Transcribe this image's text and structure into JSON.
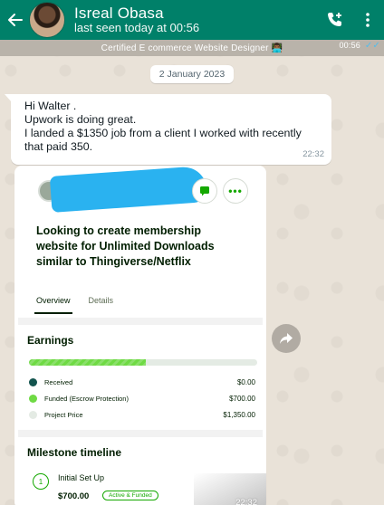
{
  "header": {
    "contact_name": "Isreal Obasa",
    "last_seen": "last seen today at 00:56"
  },
  "strip": {
    "text": "Certified E commerce Website Designer 👨🏾‍💻",
    "time": "00:56"
  },
  "date_chip": "2 January 2023",
  "message": {
    "lines": [
      "Hi Walter .",
      "Upwork is doing great.",
      "I landed a $1350 job from a client I worked with recently",
      "that paid 350."
    ],
    "time": "22:32"
  },
  "image_message": {
    "job_title": "Looking to create membership website for Unlimited Downloads similar to Thingiverse/Netflix",
    "tabs": [
      "Overview",
      "Details"
    ],
    "more_glyph": "•••",
    "earnings": {
      "title": "Earnings",
      "progress_fraction": 0.51,
      "rows": [
        {
          "label": "Received",
          "value": "$0.00",
          "color": "#13544e"
        },
        {
          "label": "Funded (Escrow Protection)",
          "value": "$700.00",
          "color": "#6fda44"
        },
        {
          "label": "Project Price",
          "value": "$1,350.00",
          "color": "#e4ebe4"
        }
      ]
    },
    "milestone": {
      "title": "Milestone timeline",
      "index": "1",
      "name": "Initial Set Up",
      "amount": "$700.00",
      "badge": "Active & Funded"
    },
    "time": "22:32"
  },
  "colors": {
    "header": "#008069",
    "upwork_green": "#14a800",
    "redaction": "#2ab2f0"
  }
}
